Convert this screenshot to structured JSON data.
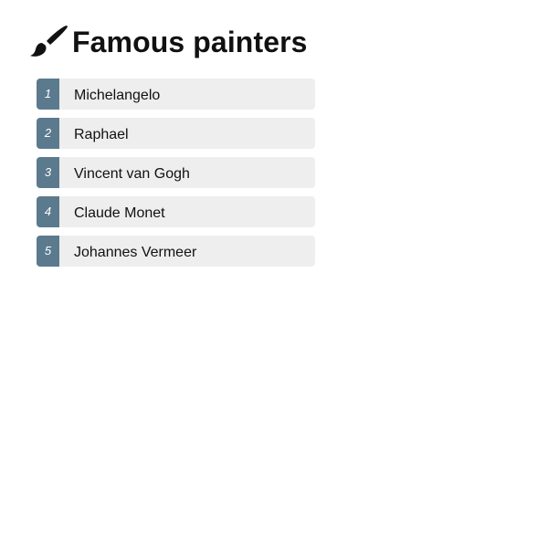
{
  "header": {
    "title": "Famous painters",
    "icon": "paintbrush-icon"
  },
  "painters": [
    {
      "number": "1",
      "name": "Michelangelo"
    },
    {
      "number": "2",
      "name": "Raphael"
    },
    {
      "number": "3",
      "name": "Vincent van Gogh"
    },
    {
      "number": "4",
      "name": "Claude Monet"
    },
    {
      "number": "5",
      "name": "Johannes Vermeer"
    }
  ],
  "colors": {
    "number_badge": "#5b7a8e",
    "item_background": "#eeeeee",
    "text": "#111111"
  }
}
